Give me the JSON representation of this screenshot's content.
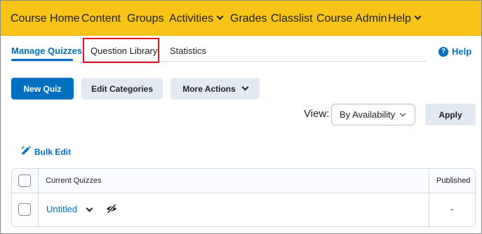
{
  "nav": {
    "items": [
      {
        "label": "Course Home"
      },
      {
        "label": "Content"
      },
      {
        "label": "Groups"
      },
      {
        "label": "Activities"
      },
      {
        "label": "Grades"
      },
      {
        "label": "Classlist"
      },
      {
        "label": "Course Admin"
      },
      {
        "label": "Help"
      }
    ],
    "background_color": "#f7c417"
  },
  "tabs": [
    {
      "label": "Manage Quizzes",
      "active": true
    },
    {
      "label": "Question Library",
      "highlighted": true
    },
    {
      "label": "Statistics"
    }
  ],
  "help": {
    "label": "Help",
    "icon": "question-circle-icon"
  },
  "toolbar": {
    "new_quiz_label": "New Quiz",
    "edit_categories_label": "Edit Categories",
    "more_actions_label": "More Actions"
  },
  "view": {
    "label": "View:",
    "selected": "By Availability",
    "apply_label": "Apply"
  },
  "bulk_edit": {
    "label": "Bulk Edit",
    "icon": "pencil-icon"
  },
  "table": {
    "headers": {
      "name": "Current Quizzes",
      "published": "Published"
    },
    "rows": [
      {
        "name": "Untitled",
        "published": "-"
      }
    ]
  },
  "colors": {
    "accent": "#006fbf",
    "highlight_border": "#e0121b"
  }
}
